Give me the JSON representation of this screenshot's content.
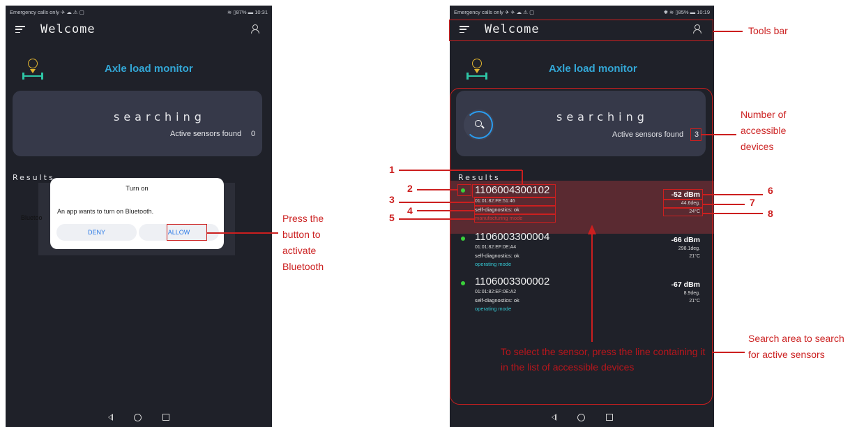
{
  "left_screen": {
    "status_left": "Emergency calls only ✈ ☁ ⚠ ▢",
    "status_right": "≋ ▯87% ▬ 10:31",
    "app_title": "Welcome",
    "brand": "Axle load monitor",
    "searching": "searching",
    "active_sensors_label": "Active sensors found",
    "active_sensors_count": "0",
    "results_label": "Results",
    "partial_text": "Bluetoo",
    "dialog": {
      "title": "Turn on",
      "message": "An app wants to turn on Bluetooth.",
      "deny": "DENY",
      "allow": "ALLOW"
    }
  },
  "right_screen": {
    "status_left": "Emergency calls only ✈ ✈ ☁ ⚠ ▢",
    "status_right": "✱ ≋ ▯85% ▬ 10:19",
    "app_title": "Welcome",
    "brand": "Axle load monitor",
    "searching": "searching",
    "active_sensors_label": "Active sensors found",
    "active_sensors_count": "3",
    "results_label": "Results",
    "sensors": [
      {
        "id": "1106004300102",
        "mac": "01:01:82:FE:51:46",
        "diag": "self-diagnostics: ok",
        "mode": "manufacturing mode",
        "rssi": "-52 dBm",
        "angle": "44.6deg.",
        "temp": "24°C"
      },
      {
        "id": "1106003300004",
        "mac": "01:01:82:EF:0E:A4",
        "diag": "self-diagnostics: ok",
        "mode": "operating mode",
        "rssi": "-66 dBm",
        "angle": "298.1deg.",
        "temp": "21°C"
      },
      {
        "id": "1106003300002",
        "mac": "01:01:82:EF:0E:A2",
        "diag": "self-diagnostics: ok",
        "mode": "operating mode",
        "rssi": "-67 dBm",
        "angle": "8.9deg.",
        "temp": "21°C"
      }
    ],
    "select_hint": "To select the sensor, press the line containing it in the list of accessible devices"
  },
  "annotations": {
    "press_button": "Press the button to activate Bluetooth",
    "tools_bar": "Tools bar",
    "number_devices": "Number of accessible devices",
    "search_area": "Search area to search for active sensors",
    "n1": "1",
    "n2": "2",
    "n3": "3",
    "n4": "4",
    "n5": "5",
    "n6": "6",
    "n7": "7",
    "n8": "8"
  },
  "colors": {
    "screen_bg": "#1f2129",
    "card_bg": "#363949",
    "accent_blue": "#33a7d6",
    "annotation_red": "#cc1f1f",
    "status_green": "#3ad13a",
    "mode_teal": "#34c6d1"
  }
}
